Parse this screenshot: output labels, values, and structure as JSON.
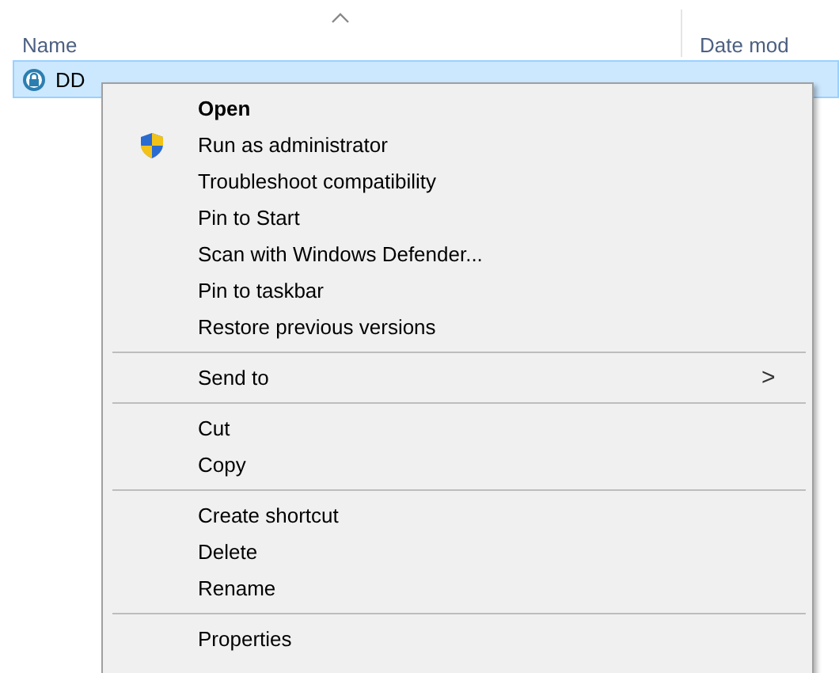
{
  "columns": [
    {
      "label": "Name",
      "sorted": true
    },
    {
      "label": "Date mod",
      "sorted": false
    }
  ],
  "rows": [
    {
      "name": "DD",
      "selected": true
    }
  ],
  "context_menu": {
    "groups": [
      [
        {
          "kind": "plain",
          "label": "Open",
          "default": true
        },
        {
          "kind": "admin",
          "label": "Run as administrator",
          "default": false
        },
        {
          "kind": "plain",
          "label": "Troubleshoot compatibility",
          "default": false
        },
        {
          "kind": "plain",
          "label": "Pin to Start",
          "default": false
        },
        {
          "kind": "plain",
          "label": "Scan with Windows Defender...",
          "default": false
        },
        {
          "kind": "plain",
          "label": "Pin to taskbar",
          "default": false
        },
        {
          "kind": "plain",
          "label": "Restore previous versions",
          "default": false
        }
      ],
      [
        {
          "kind": "submenu",
          "label": "Send to",
          "default": false,
          "arrow": ">"
        }
      ],
      [
        {
          "kind": "plain",
          "label": "Cut",
          "default": false
        },
        {
          "kind": "plain",
          "label": "Copy",
          "default": false
        }
      ],
      [
        {
          "kind": "plain",
          "label": "Create shortcut",
          "default": false
        },
        {
          "kind": "plain",
          "label": "Delete",
          "default": false
        },
        {
          "kind": "plain",
          "label": "Rename",
          "default": false
        }
      ],
      [
        {
          "kind": "plain",
          "label": "Properties",
          "default": false
        }
      ]
    ]
  }
}
